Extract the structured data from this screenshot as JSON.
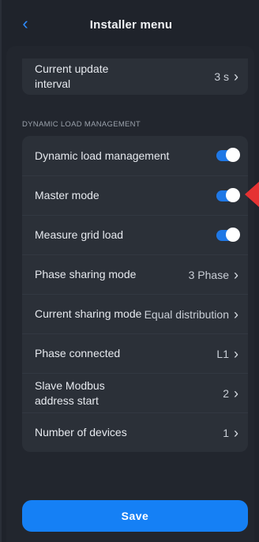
{
  "header": {
    "title": "Installer menu",
    "back_icon": "chevron-left"
  },
  "update": {
    "label": "Current update interval",
    "value": "3 s"
  },
  "section": {
    "title": "DYNAMIC LOAD MANAGEMENT"
  },
  "dlm": {
    "rows": [
      {
        "label": "Dynamic load management",
        "toggle": true
      },
      {
        "label": "Master mode",
        "toggle": true
      },
      {
        "label": "Measure grid load",
        "toggle": true
      },
      {
        "label": "Phase sharing mode",
        "value": "3 Phase"
      },
      {
        "label": "Current sharing mode",
        "value": "Equal distribution"
      },
      {
        "label": "Phase connected",
        "value": "L1"
      },
      {
        "label": "Slave Modbus address start",
        "value": "2"
      },
      {
        "label": "Number of devices",
        "value": "1"
      }
    ]
  },
  "save": {
    "label": "Save"
  },
  "colors": {
    "accent": "#1580f5",
    "toggle_on": "#1f78e6",
    "pointer": "#e53232"
  }
}
